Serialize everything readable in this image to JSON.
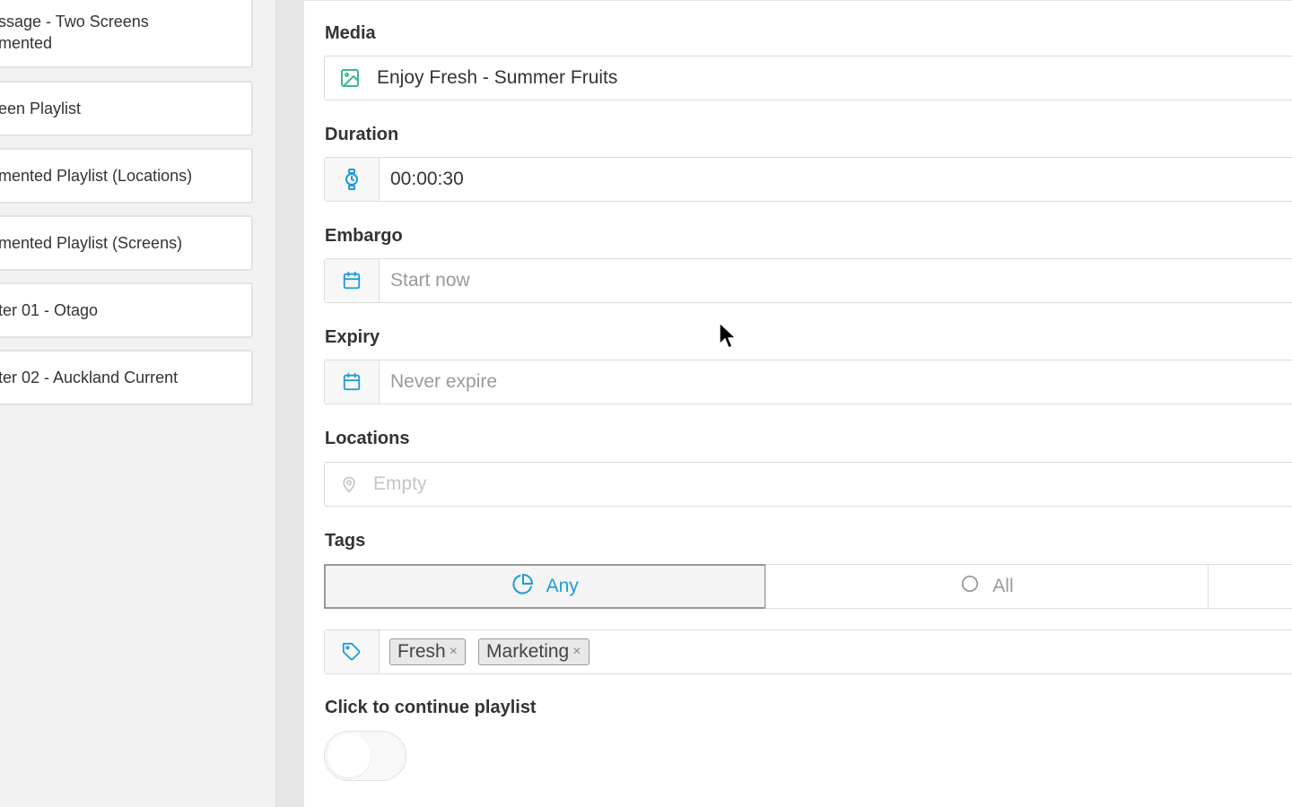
{
  "sidebar": {
    "items": [
      {
        "label": "ssage - Two Screens\nmented"
      },
      {
        "label": "een Playlist"
      },
      {
        "label": "mented Playlist (Locations)"
      },
      {
        "label": "mented Playlist (Screens)"
      },
      {
        "label": "ter 01 - Otago"
      },
      {
        "label": "ter 02 - Auckland Current"
      }
    ]
  },
  "form": {
    "media": {
      "label": "Media",
      "value": "Enjoy Fresh - Summer Fruits",
      "icon": "image-icon"
    },
    "duration": {
      "label": "Duration",
      "value": "00:00:30",
      "icon": "stopwatch-icon"
    },
    "embargo": {
      "label": "Embargo",
      "placeholder": "Start now",
      "icon": "calendar-icon"
    },
    "expiry": {
      "label": "Expiry",
      "placeholder": "Never expire",
      "icon": "calendar-icon"
    },
    "locations": {
      "label": "Locations",
      "placeholder": "Empty",
      "icon": "location-pin-icon"
    },
    "tags": {
      "label": "Tags",
      "match_modes": [
        {
          "label": "Any",
          "active": true,
          "icon": "pie-chart-icon"
        },
        {
          "label": "All",
          "active": false,
          "icon": "circle-icon"
        }
      ],
      "chips": [
        {
          "label": "Fresh",
          "remove": "×"
        },
        {
          "label": "Marketing",
          "remove": "×"
        }
      ],
      "icon": "tag-icon"
    },
    "continue": {
      "label": "Click to continue playlist",
      "enabled": false
    }
  },
  "colors": {
    "accent": "#1e9bd7",
    "media_icon": "#3bb98a",
    "muted": "#9a9a9a"
  }
}
